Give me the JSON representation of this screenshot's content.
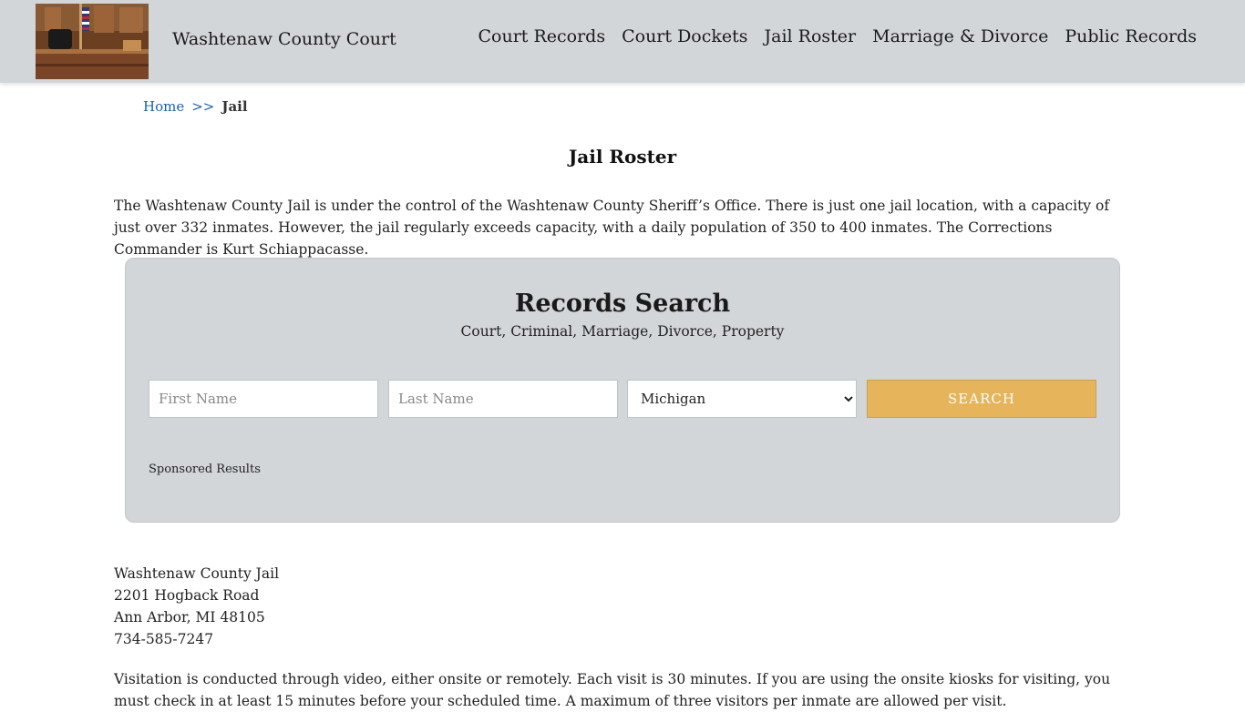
{
  "header": {
    "site_title": "Washtenaw County Court",
    "logo_alt": "courtroom-image",
    "nav": [
      {
        "label": "Court Records"
      },
      {
        "label": "Court Dockets"
      },
      {
        "label": "Jail Roster"
      },
      {
        "label": "Marriage & Divorce"
      },
      {
        "label": "Public Records"
      }
    ]
  },
  "breadcrumb": {
    "home": "Home",
    "separator": ">>",
    "current": "Jail"
  },
  "page_title": "Jail Roster",
  "intro": "The Washtenaw County Jail is under the control of the Washtenaw County Sheriff’s Office. There is just one jail location, with a capacity of just over 332 inmates. However, the jail regularly exceeds capacity, with a daily population of 350 to 400 inmates. The Corrections Commander is Kurt Schiappacasse.",
  "search": {
    "title": "Records Search",
    "subtitle": "Court, Criminal, Marriage, Divorce, Property",
    "first_name_placeholder": "First Name",
    "last_name_placeholder": "Last Name",
    "state_selected": "Michigan",
    "button_label": "Search",
    "sponsored": "Sponsored Results"
  },
  "address": {
    "name": "Washtenaw County Jail",
    "street": "2201 Hogback Road",
    "city": "Ann Arbor, MI 48105",
    "phone": "734-585-7247"
  },
  "visitation": "Visitation is conducted through video, either onsite or remotely. Each visit is 30 minutes. If you are using the onsite kiosks for visiting, you must check in at least 15 minutes before your scheduled time. A maximum of three visitors per inmate are allowed per visit."
}
